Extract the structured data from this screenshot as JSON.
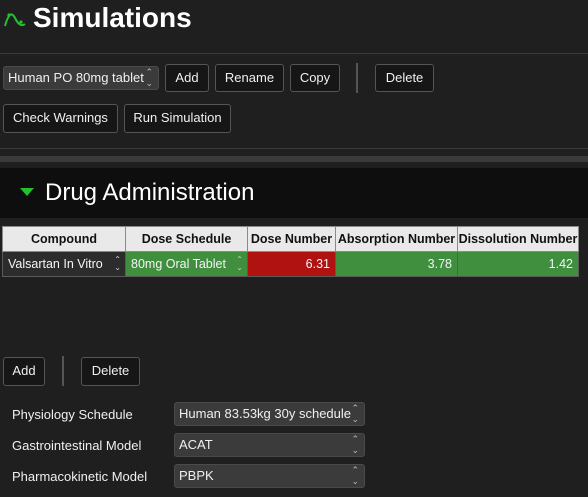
{
  "header": {
    "title": "Simulations",
    "icon": "simulation-curve-icon",
    "accent": "#22c12e"
  },
  "toolbar": {
    "simulation_select": "Human PO 80mg tablet",
    "add": "Add",
    "rename": "Rename",
    "copy": "Copy",
    "delete": "Delete",
    "check_warnings": "Check Warnings",
    "run_simulation": "Run Simulation"
  },
  "section": {
    "title": "Drug Administration",
    "expanded": true
  },
  "table": {
    "columns": [
      "Compound",
      "Dose Schedule",
      "Dose Number",
      "Absorption Number",
      "Dissolution Number"
    ],
    "rows": [
      {
        "compound": "Valsartan In Vitro",
        "dose_schedule": "80mg Oral Tablet",
        "dose_number": "6.31",
        "absorption_number": "3.78",
        "dissolution_number": "1.42"
      }
    ],
    "colors": {
      "warning": "#b01212",
      "ok": "#3f8f3f"
    }
  },
  "row_actions": {
    "add": "Add",
    "delete": "Delete"
  },
  "settings": {
    "physiology_label": "Physiology Schedule",
    "physiology_value": "Human 83.53kg 30y schedule",
    "gi_label": "Gastrointestinal Model",
    "gi_value": "ACAT",
    "pk_label": "Pharmacokinetic Model",
    "pk_value": "PBPK"
  }
}
